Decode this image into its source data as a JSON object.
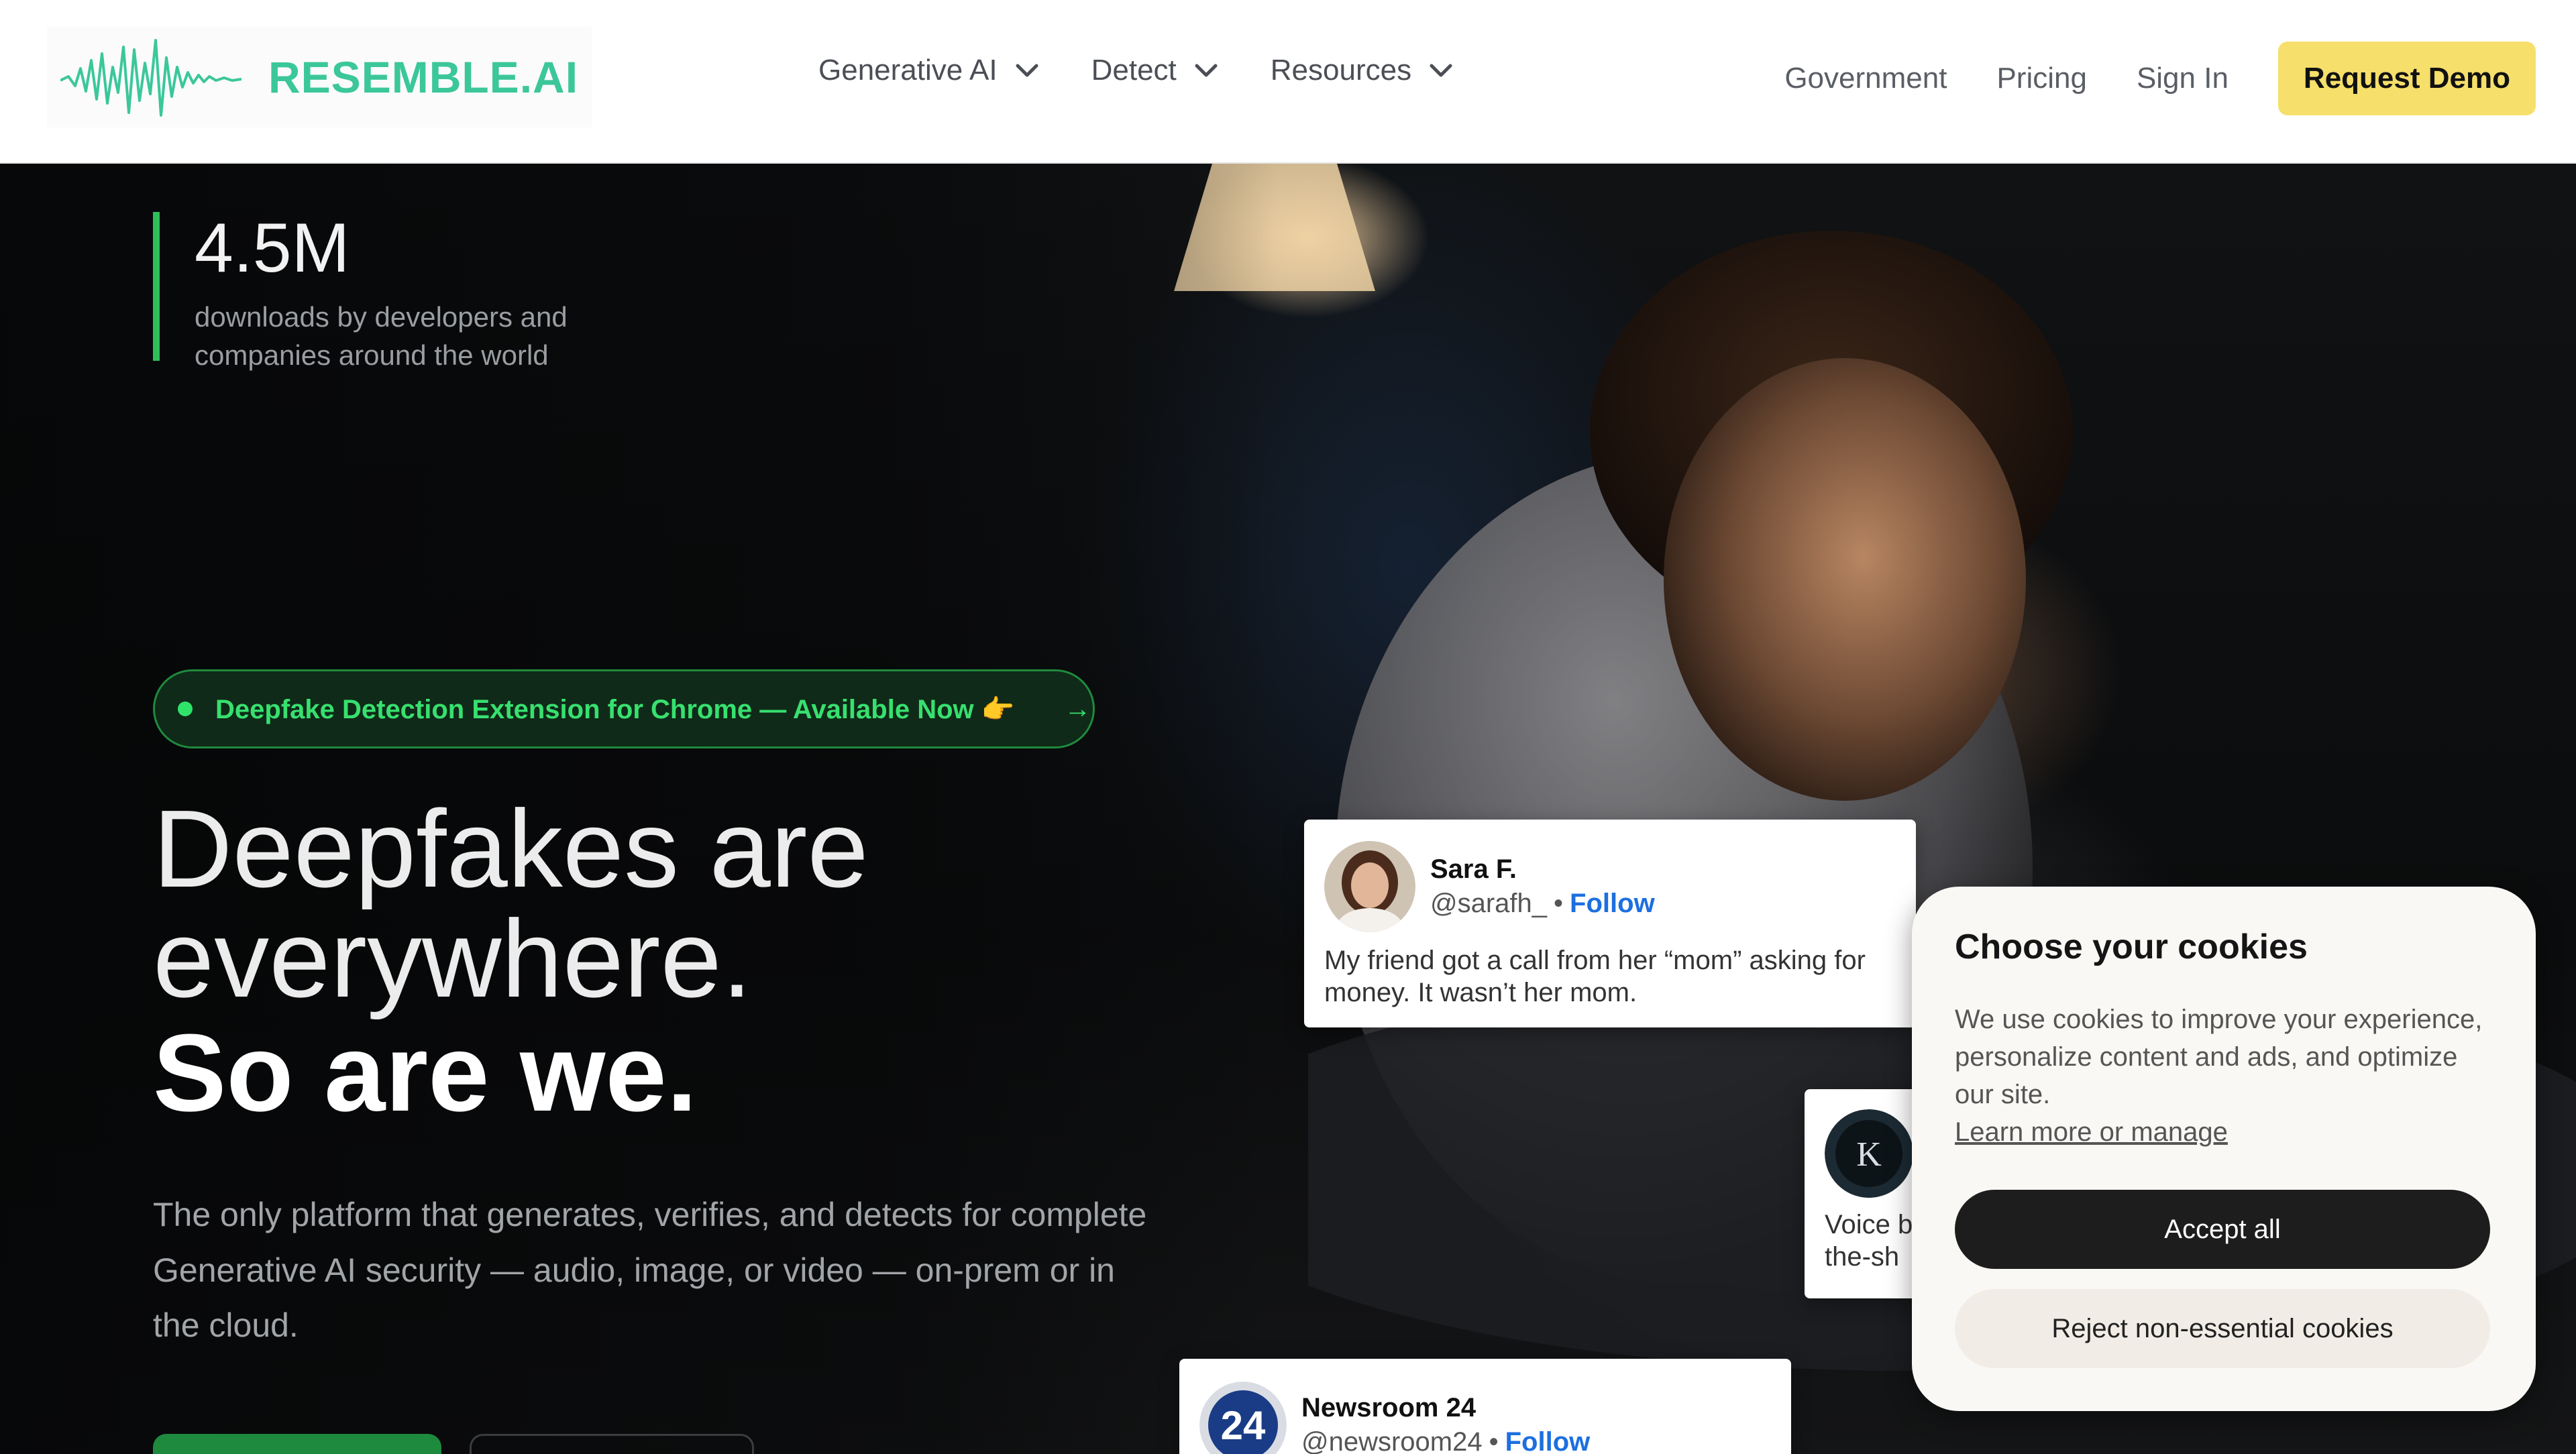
{
  "nav": {
    "brand": "RESEMBLE.AI",
    "menu": [
      {
        "label": "Generative AI"
      },
      {
        "label": "Detect"
      },
      {
        "label": "Resources"
      }
    ],
    "links": [
      "Government",
      "Pricing",
      "Sign In"
    ],
    "cta": "Request Demo",
    "colors": {
      "brand": "#3bc79a",
      "cta_bg": "#f6df6a"
    }
  },
  "hero": {
    "stat_value": "4.5M",
    "stat_desc": "downloads by developers and companies around the world",
    "pill": "Deepfake Detection Extension for Chrome — Available Now 👉",
    "pill_arrow": "→",
    "headline_line1": "Deepfakes are",
    "headline_line2": "everywhere.",
    "headline_bold": "So are we.",
    "subcopy": "The only platform that generates, verifies, and detects for complete Generative AI security — audio, image, or video — on-prem or in the cloud.",
    "colors": {
      "accent_green": "#2fbf5a"
    }
  },
  "cards": {
    "sara": {
      "name": "Sara F.",
      "handle": "@sarafh_",
      "sep": "•",
      "follow": "Follow",
      "text": "My friend got a call from her “mom” asking for money. It wasn’t her mom."
    },
    "voice": {
      "line1": "Voice b",
      "line2": "the-sh"
    },
    "news": {
      "name": "Newsroom 24",
      "handle": "@newsroom24",
      "sep": "•",
      "follow": "Follow"
    }
  },
  "cookie": {
    "title": "Choose your cookies",
    "body": "We use cookies to improve your experience, personalize content and ads, and optimize our site.",
    "link": "Learn more or manage",
    "accept": "Accept all",
    "reject": "Reject non-essential cookies"
  }
}
